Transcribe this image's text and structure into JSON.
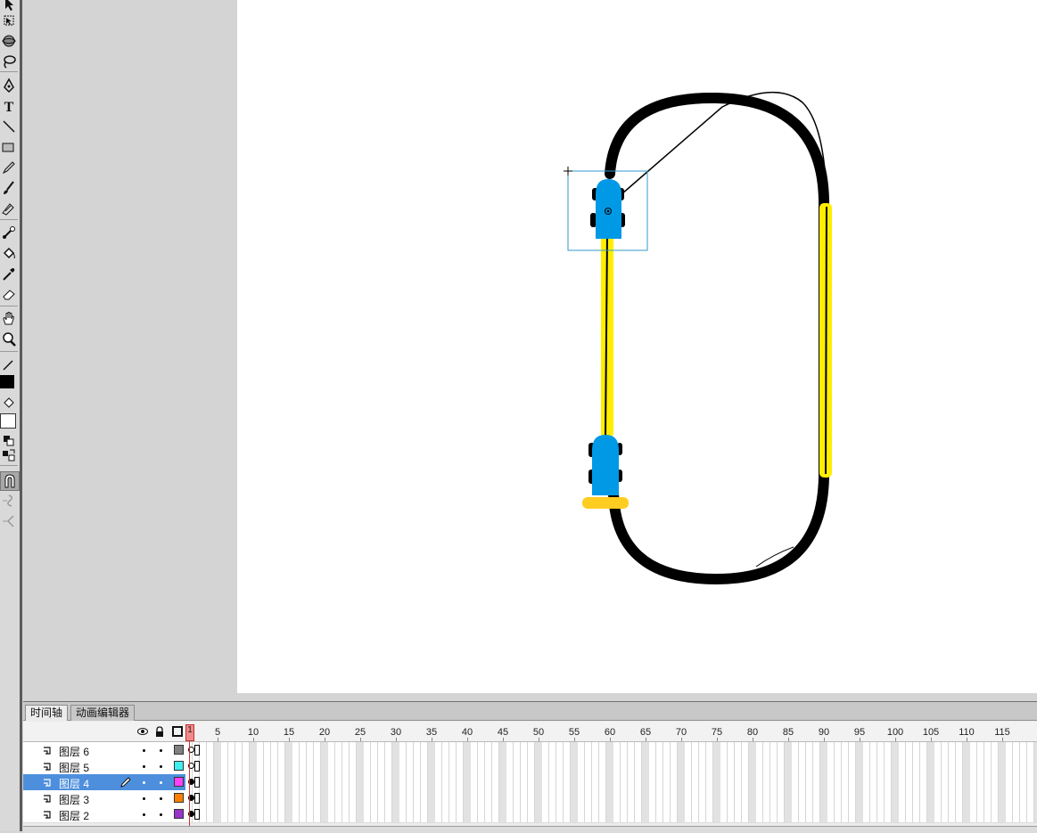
{
  "toolbar": {
    "tools": [
      {
        "name": "selection-tool-icon"
      },
      {
        "name": "free-transform-tool-icon"
      },
      {
        "name": "3d-rotation-tool-icon"
      },
      {
        "name": "lasso-tool-icon"
      },
      {
        "name": "pen-tool-icon"
      },
      {
        "name": "text-tool-icon",
        "glyph": "T"
      },
      {
        "name": "line-tool-icon"
      },
      {
        "name": "rectangle-tool-icon"
      },
      {
        "name": "pencil-tool-icon"
      },
      {
        "name": "brush-tool-icon"
      },
      {
        "name": "deco-tool-icon"
      },
      {
        "name": "bone-tool-icon"
      },
      {
        "name": "paint-bucket-tool-icon"
      },
      {
        "name": "eyedropper-tool-icon"
      },
      {
        "name": "eraser-tool-icon"
      },
      {
        "name": "hand-tool-icon"
      },
      {
        "name": "zoom-tool-icon"
      }
    ],
    "stroke_color": "#000000",
    "fill_color": "#ffffff"
  },
  "timeline": {
    "tabs": [
      {
        "label": "时间轴",
        "active": true
      },
      {
        "label": "动画编辑器",
        "active": false
      }
    ],
    "frame_numbers": [
      "1",
      "5",
      "10",
      "15",
      "20",
      "25",
      "30",
      "35",
      "40",
      "45",
      "50",
      "55",
      "60",
      "65",
      "70",
      "75",
      "80",
      "85",
      "90",
      "95",
      "100",
      "105",
      "110",
      "115"
    ],
    "current_frame": "1",
    "layers": [
      {
        "name": "图层 6",
        "color": "#808080",
        "keyframe": "hollow",
        "selected": false
      },
      {
        "name": "图层 5",
        "color": "#40f0f0",
        "keyframe": "hollow",
        "selected": false
      },
      {
        "name": "图层 4",
        "color": "#ff40ff",
        "keyframe": "filled",
        "selected": true
      },
      {
        "name": "图层 3",
        "color": "#ff8000",
        "keyframe": "filled",
        "selected": false
      },
      {
        "name": "图层 2",
        "color": "#9933cc",
        "keyframe": "filled",
        "selected": false
      }
    ]
  },
  "colors": {
    "track": "#000000",
    "rail": "#ffee00",
    "car": "#0099e6",
    "platform": "#ffcc22",
    "selection": "#3399cc"
  }
}
